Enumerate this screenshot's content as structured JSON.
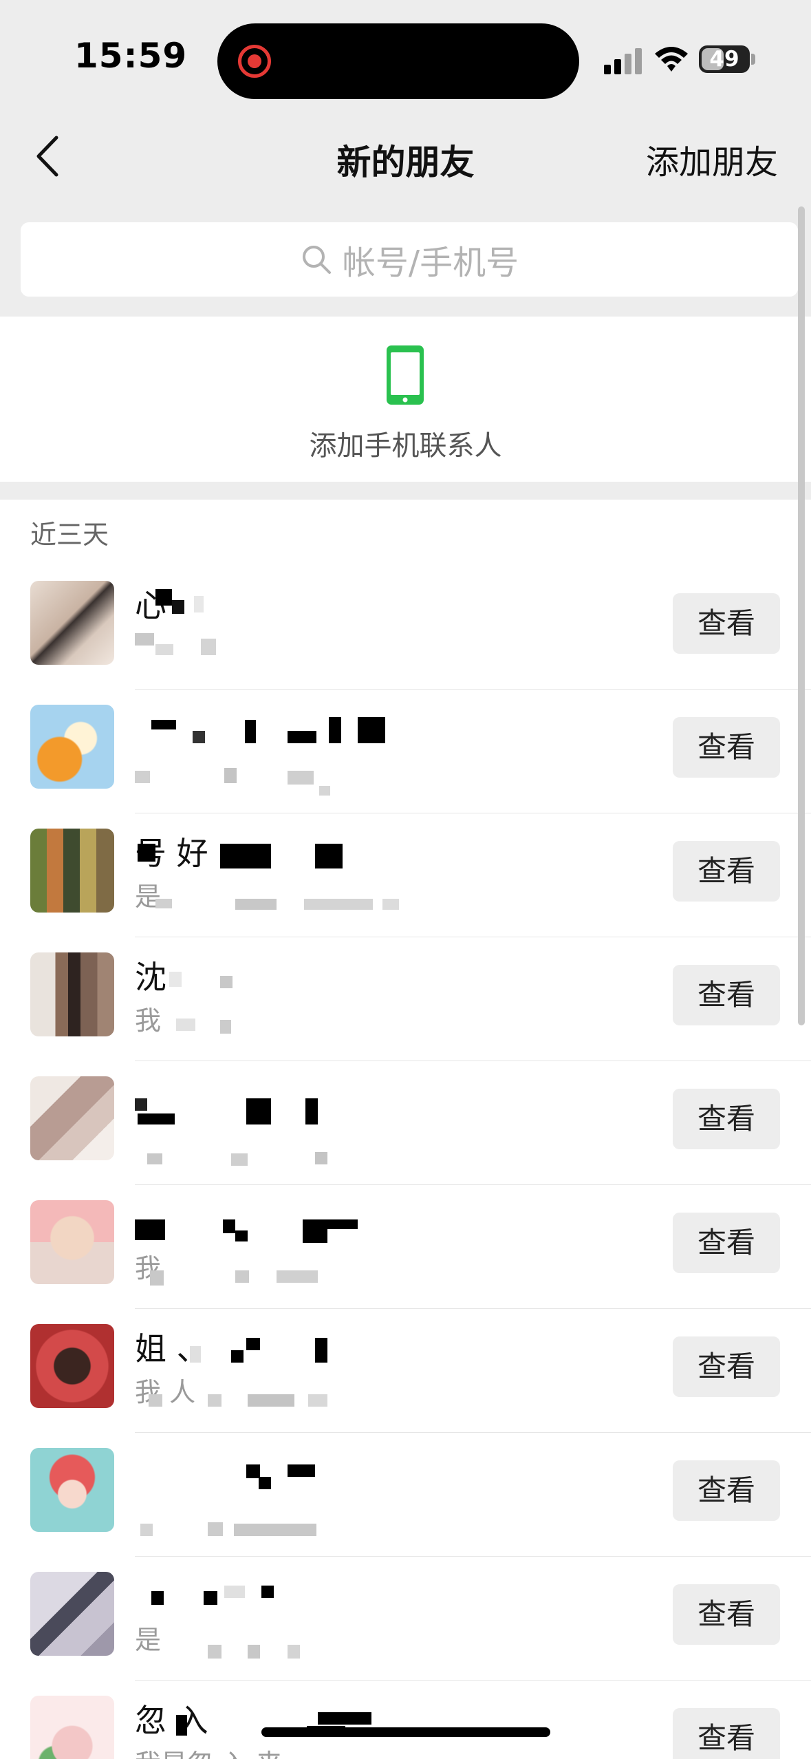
{
  "status_bar": {
    "time": "15:59",
    "battery": "49",
    "battery_level": 0.49
  },
  "header": {
    "title": "新的朋友",
    "action": "添加朋友"
  },
  "search": {
    "placeholder": "帐号/手机号"
  },
  "add_contacts": {
    "label": "添加手机联系人"
  },
  "section": {
    "title": "近三天"
  },
  "view_label": "查看",
  "requests": [
    {
      "name": "心",
      "subtitle": ""
    },
    {
      "name": "",
      "subtitle": ""
    },
    {
      "name": "号 好",
      "subtitle": "是"
    },
    {
      "name": "沈",
      "subtitle": "我"
    },
    {
      "name": "",
      "subtitle": ""
    },
    {
      "name": "",
      "subtitle": "我"
    },
    {
      "name": "姐 、",
      "subtitle": "我 人"
    },
    {
      "name": "",
      "subtitle": ""
    },
    {
      "name": "",
      "subtitle": "是"
    },
    {
      "name": "忽 入",
      "subtitle": "我是忽 入 来"
    }
  ],
  "colors": {
    "accent_green": "#2AC14F",
    "record_red": "#E53935",
    "header_bg": "#EDEDED"
  }
}
